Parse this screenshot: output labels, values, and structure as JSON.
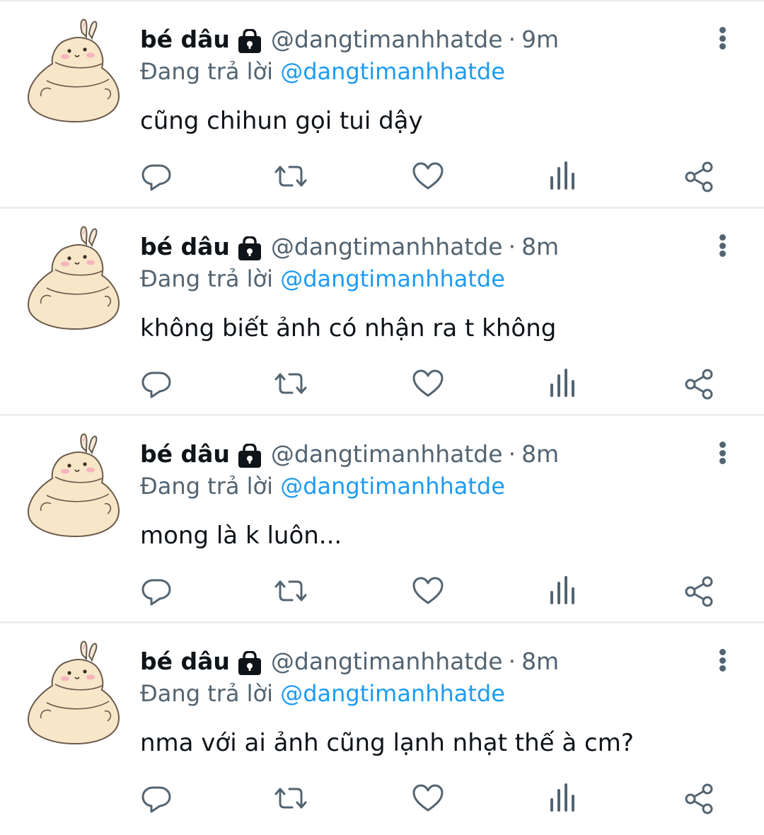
{
  "colors": {
    "text_primary": "#0f1419",
    "text_secondary": "#536471",
    "link": "#1d9bf0",
    "divider": "#eceef0"
  },
  "icons": {
    "lock": "lock-icon",
    "more": "more-vertical-icon",
    "reply": "reply-icon",
    "retweet": "retweet-icon",
    "like": "heart-icon",
    "views": "analytics-icon",
    "share": "share-icon"
  },
  "tweets": [
    {
      "name": "bé dâu",
      "handle": "@dangtimanhhatde",
      "separator": "·",
      "time": "9m",
      "reply_prefix": "Đang trả lời ",
      "reply_to": "@dangtimanhhatde",
      "text": "cũng chihun gọi tui dậy"
    },
    {
      "name": "bé dâu",
      "handle": "@dangtimanhhatde",
      "separator": "·",
      "time": "8m",
      "reply_prefix": "Đang trả lời ",
      "reply_to": "@dangtimanhhatde",
      "text": "không biết ảnh có nhận ra t không"
    },
    {
      "name": "bé dâu",
      "handle": "@dangtimanhhatde",
      "separator": "·",
      "time": "8m",
      "reply_prefix": "Đang trả lời ",
      "reply_to": "@dangtimanhhatde",
      "text": "mong là k luôn..."
    },
    {
      "name": "bé dâu",
      "handle": "@dangtimanhhatde",
      "separator": "·",
      "time": "8m",
      "reply_prefix": "Đang trả lời ",
      "reply_to": "@dangtimanhhatde",
      "text": "nma với ai ảnh cũng lạnh nhạt thế à cm?"
    }
  ]
}
